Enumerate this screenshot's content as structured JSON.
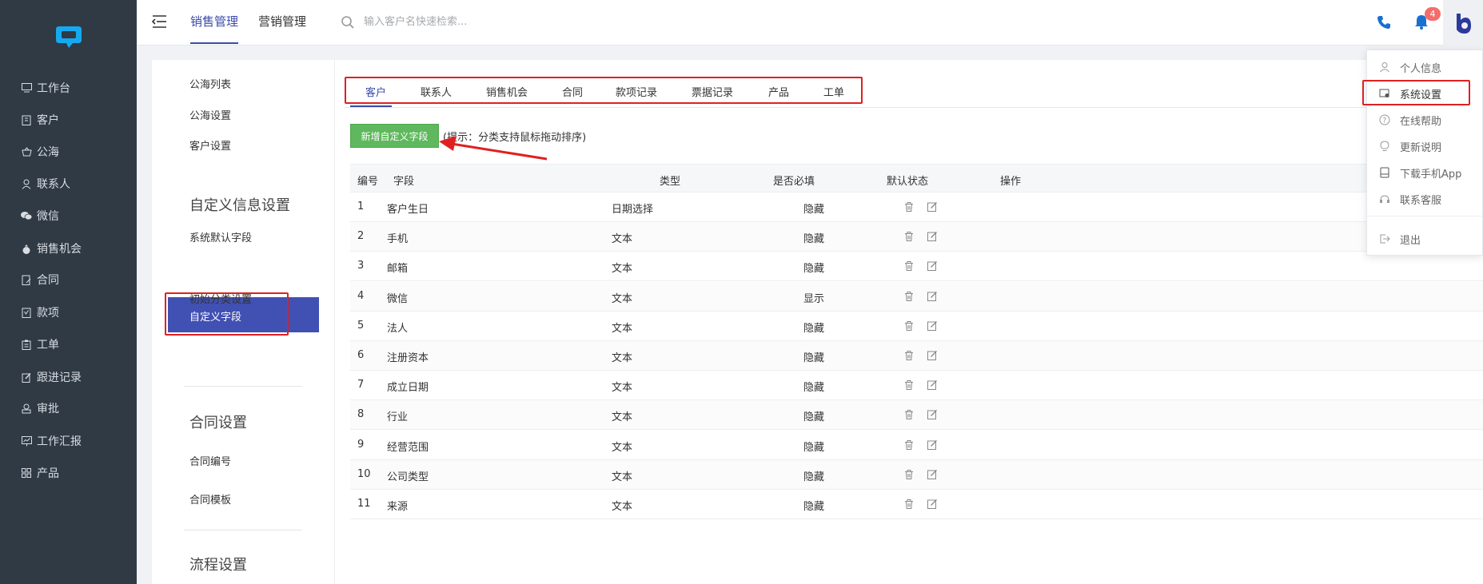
{
  "sidebar": {
    "items": [
      {
        "label": "工作台",
        "icon": "monitor-icon"
      },
      {
        "label": "客户",
        "icon": "building-icon"
      },
      {
        "label": "公海",
        "icon": "basket-icon"
      },
      {
        "label": "联系人",
        "icon": "user-icon"
      },
      {
        "label": "微信",
        "icon": "wechat-icon"
      },
      {
        "label": "销售机会",
        "icon": "money-bag-icon"
      },
      {
        "label": "合同",
        "icon": "contract-icon"
      },
      {
        "label": "款项",
        "icon": "payment-icon"
      },
      {
        "label": "工单",
        "icon": "clipboard-icon"
      },
      {
        "label": "跟进记录",
        "icon": "edit-icon"
      },
      {
        "label": "审批",
        "icon": "stamp-icon"
      },
      {
        "label": "工作汇报",
        "icon": "report-icon"
      },
      {
        "label": "产品",
        "icon": "grid-icon"
      }
    ]
  },
  "header": {
    "tabs": [
      {
        "label": "销售管理",
        "active": true
      },
      {
        "label": "营销管理",
        "active": false
      }
    ],
    "search": {
      "placeholder": "输入客户名快速检索...",
      "value": ""
    },
    "notification_count": "4",
    "avatar_letter": "b"
  },
  "settings_nav": {
    "top_items": [
      "公海列表",
      "公海设置",
      "客户设置"
    ],
    "groups": [
      {
        "title": "自定义信息设置",
        "items": [
          "系统默认字段",
          "自定义字段",
          "初始分类设置"
        ],
        "active": "自定义字段"
      },
      {
        "title": "合同设置",
        "items": [
          "合同编号",
          "合同模板"
        ]
      },
      {
        "title": "流程设置",
        "items": []
      }
    ]
  },
  "main": {
    "tabs": [
      "客户",
      "联系人",
      "销售机会",
      "合同",
      "款项记录",
      "票据记录",
      "产品",
      "工单"
    ],
    "active_tab": "客户",
    "add_button": "新增自定义字段",
    "hint": "(提示：分类支持鼠标拖动排序)",
    "columns": [
      "编号",
      "字段",
      "类型",
      "是否必填",
      "默认状态",
      "操作"
    ],
    "rows": [
      {
        "no": "1",
        "field": "客户生日",
        "type": "日期选择",
        "required": "",
        "status": "隐藏"
      },
      {
        "no": "2",
        "field": "手机",
        "type": "文本",
        "required": "",
        "status": "隐藏"
      },
      {
        "no": "3",
        "field": "邮箱",
        "type": "文本",
        "required": "",
        "status": "隐藏"
      },
      {
        "no": "4",
        "field": "微信",
        "type": "文本",
        "required": "",
        "status": "显示"
      },
      {
        "no": "5",
        "field": "法人",
        "type": "文本",
        "required": "",
        "status": "隐藏"
      },
      {
        "no": "6",
        "field": "注册资本",
        "type": "文本",
        "required": "",
        "status": "隐藏"
      },
      {
        "no": "7",
        "field": "成立日期",
        "type": "文本",
        "required": "",
        "status": "隐藏"
      },
      {
        "no": "8",
        "field": "行业",
        "type": "文本",
        "required": "",
        "status": "隐藏"
      },
      {
        "no": "9",
        "field": "经营范围",
        "type": "文本",
        "required": "",
        "status": "隐藏"
      },
      {
        "no": "10",
        "field": "公司类型",
        "type": "文本",
        "required": "",
        "status": "隐藏"
      },
      {
        "no": "11",
        "field": "来源",
        "type": "文本",
        "required": "",
        "status": "隐藏"
      }
    ]
  },
  "dropdown": {
    "items": [
      {
        "label": "个人信息",
        "icon": "person-icon"
      },
      {
        "label": "系统设置",
        "icon": "settings-icon"
      },
      {
        "label": "在线帮助",
        "icon": "help-icon"
      },
      {
        "label": "更新说明",
        "icon": "lightbulb-icon"
      },
      {
        "label": "下载手机App",
        "icon": "download-icon"
      },
      {
        "label": "联系客服",
        "icon": "headset-icon"
      },
      {
        "label": "退出",
        "icon": "logout-icon"
      }
    ]
  },
  "colors": {
    "sidebar_bg": "#2f3a45",
    "accent": "#3b4ba9",
    "active_nav_bg": "#4150b3",
    "add_button": "#5fb85d",
    "highlight_box": "#e02020",
    "badge": "#f56c6c"
  }
}
